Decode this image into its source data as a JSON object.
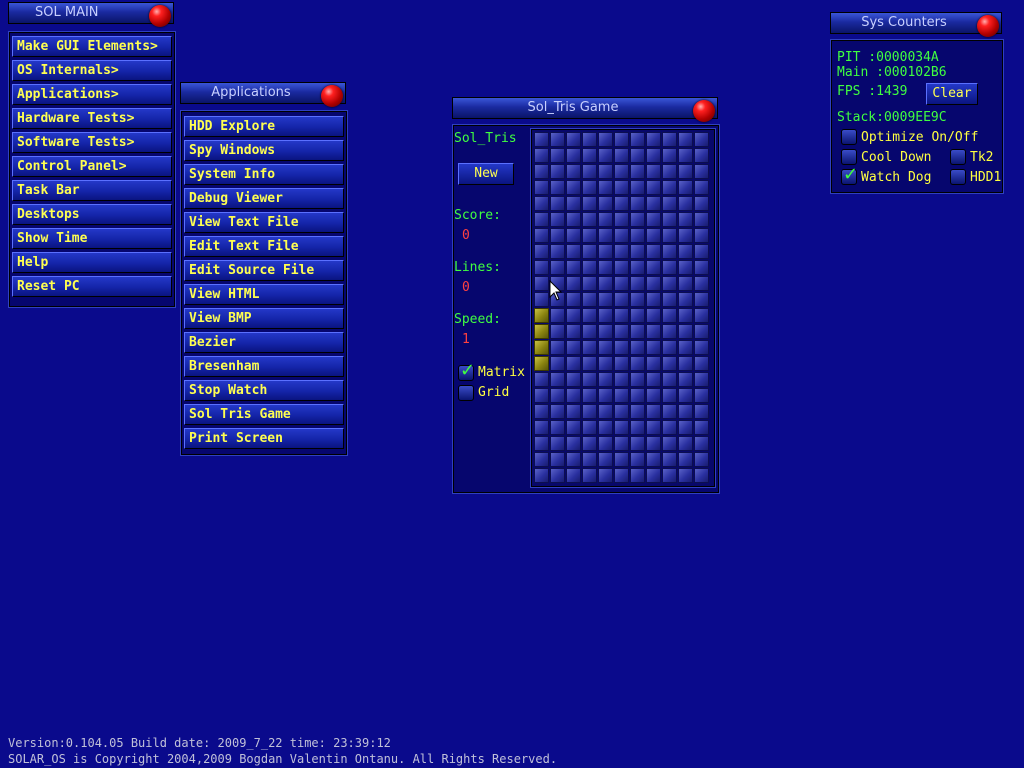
{
  "sol_main": {
    "title": "SOL MAIN",
    "items": [
      "Make GUI Elements>",
      "OS Internals>",
      "Applications>",
      "Hardware Tests>",
      "Software Tests>",
      "Control Panel>",
      "Task Bar",
      "Desktops",
      "Show Time",
      "Help",
      "Reset PC"
    ]
  },
  "applications": {
    "title": "Applications",
    "items": [
      "HDD Explore",
      "Spy Windows",
      "System Info",
      "Debug Viewer",
      "View Text File",
      "Edit Text File",
      "Edit Source File",
      "View HTML",
      "View BMP",
      "Bezier",
      "Bresenham",
      "Stop Watch",
      "Sol Tris Game",
      "Print Screen"
    ]
  },
  "game": {
    "title": "Sol_Tris Game",
    "name_label": "Sol_Tris",
    "new_button": "New",
    "score_label": "Score:",
    "score_value": "0",
    "lines_label": "Lines:",
    "lines_value": "0",
    "speed_label": "Speed:",
    "speed_value": "1",
    "matrix_label": "Matrix",
    "matrix_checked": true,
    "grid_label": "Grid",
    "grid_checked": false,
    "board": {
      "cols": 11,
      "rows": 22,
      "filled": [
        [
          0,
          11
        ],
        [
          0,
          12
        ],
        [
          0,
          13
        ],
        [
          0,
          14
        ]
      ]
    }
  },
  "sys_counters": {
    "title": "Sys Counters",
    "pit": "PIT  :0000034A",
    "main": "Main :000102B6",
    "fps": "FPS  :1439",
    "clear_button": "Clear",
    "stack": "Stack:0009EE9C",
    "optimize": "Optimize On/Off",
    "cool_down": "Cool Down",
    "watch_dog": "Watch Dog",
    "watch_dog_checked": true,
    "tk2": "Tk2",
    "hdd1": "HDD1"
  },
  "footer": {
    "version": "Version:0.104.05  Build date: 2009_7_22  time: 23:39:12",
    "copyright": "SOLAR_OS is Copyright 2004,2009 Bogdan Valentin Ontanu. All Rights Reserved."
  },
  "colors": {
    "desktop": "#0a0a8c",
    "menu_text": "#ffff50",
    "accent_green": "#40ff40",
    "value_red": "#ff4040"
  }
}
